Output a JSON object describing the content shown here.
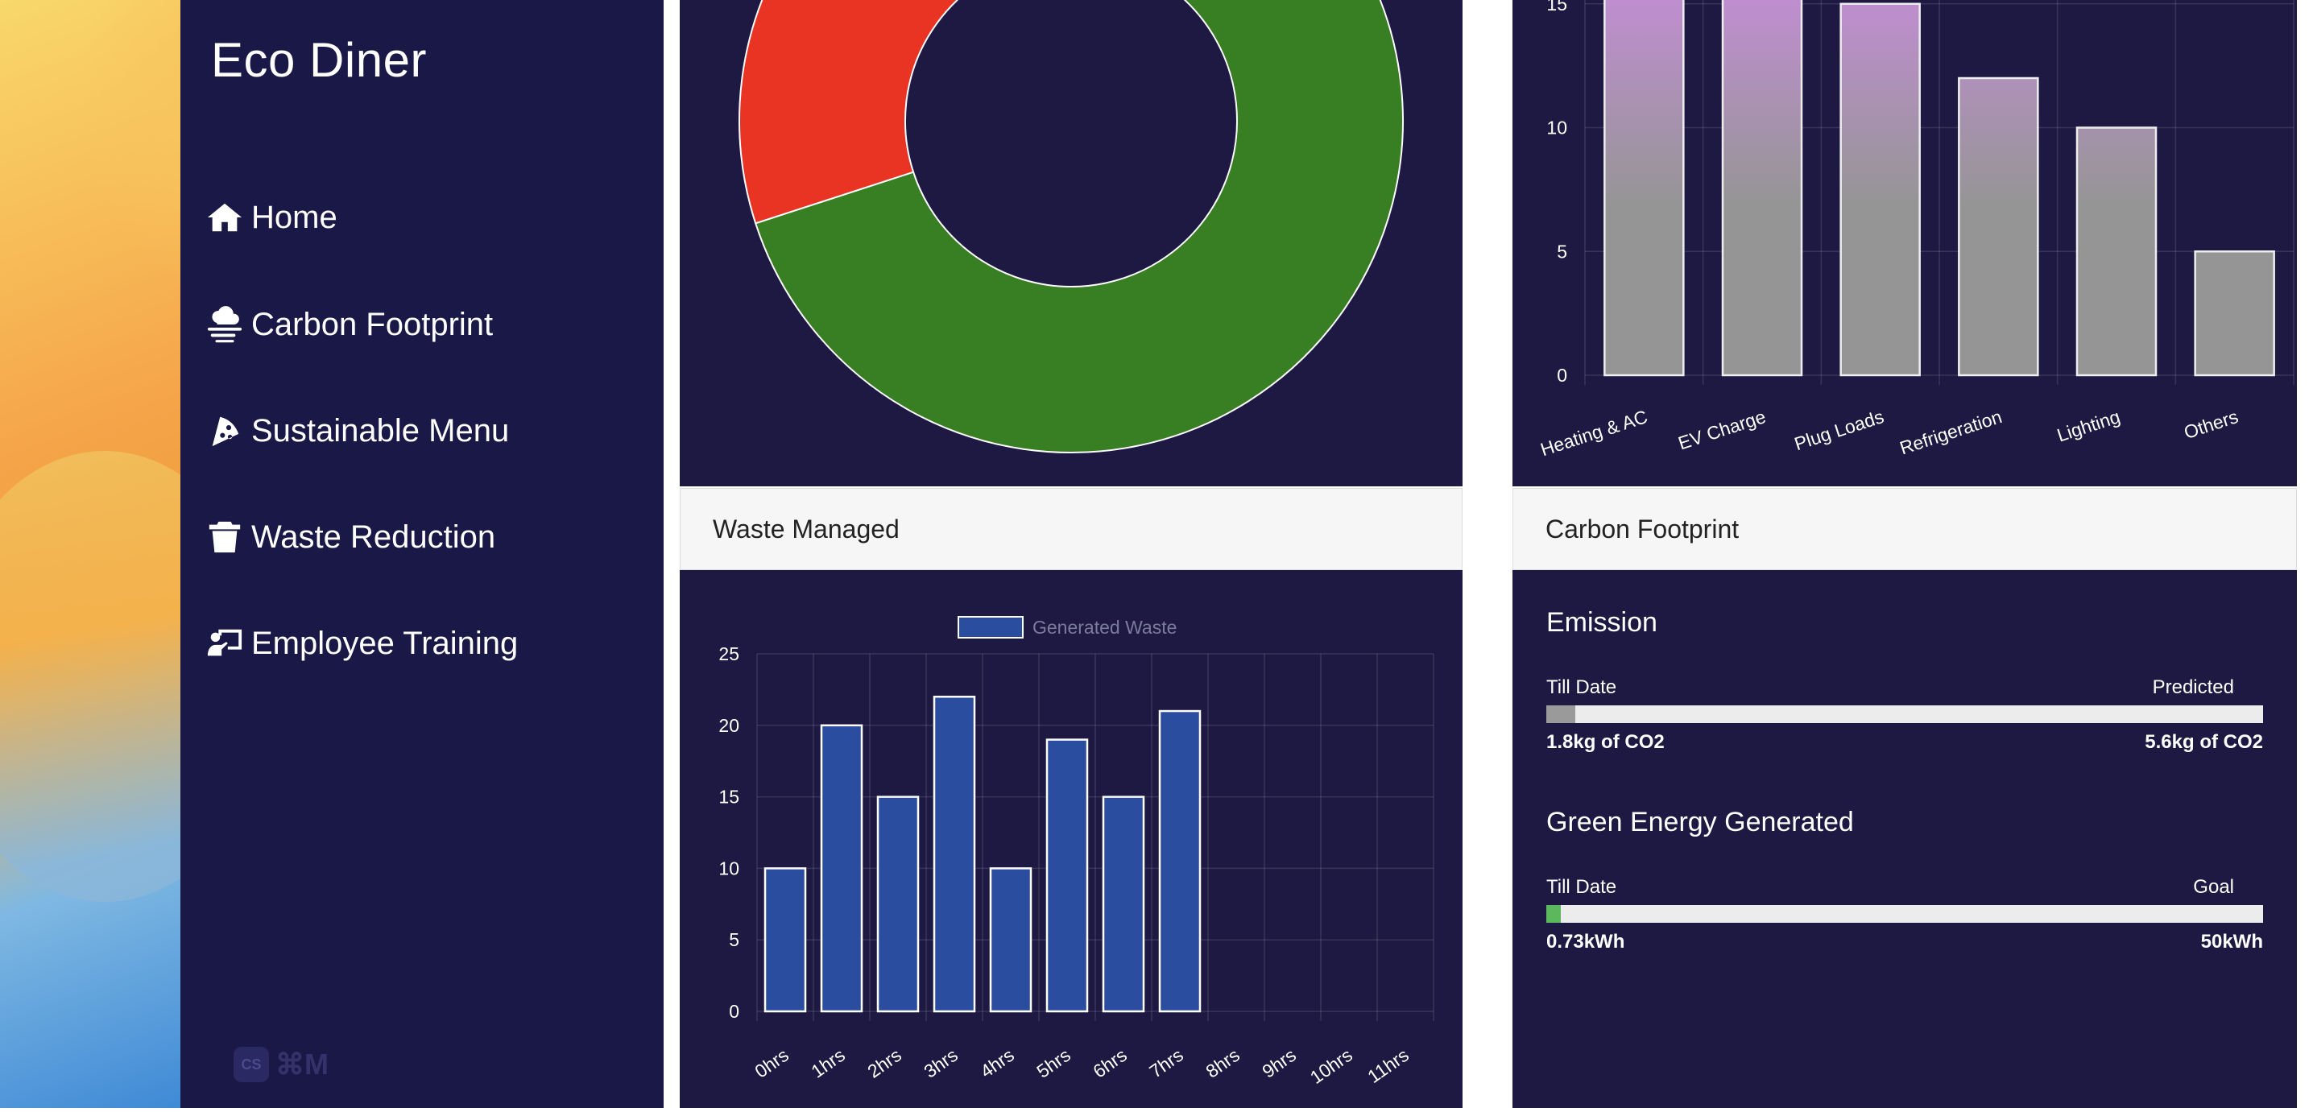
{
  "app": {
    "brand": "Eco Diner"
  },
  "sidebar": {
    "items": [
      {
        "label": "Home",
        "icon": "home-icon"
      },
      {
        "label": "Carbon Footprint",
        "icon": "cloud-smog-icon"
      },
      {
        "label": "Sustainable Menu",
        "icon": "pizza-slice-icon"
      },
      {
        "label": "Waste Reduction",
        "icon": "trash-icon"
      },
      {
        "label": "Employee Training",
        "icon": "chalkboard-teacher-icon"
      }
    ],
    "shortcut_hint": "⌘M",
    "shortcut_badge": "CS"
  },
  "waste_panel": {
    "title": "Waste Managed"
  },
  "carbon_panel": {
    "title": "Carbon Footprint",
    "emission": {
      "heading": "Emission",
      "left_label": "Till Date",
      "right_label": "Predicted",
      "left_value": "1.8kg of CO2",
      "right_value": "5.6kg of CO2",
      "fill_fraction": 0.04,
      "fill_color": "#9a9a9a"
    },
    "green_energy": {
      "heading": "Green Energy Generated",
      "left_label": "Till Date",
      "right_label": "Goal",
      "left_value": "0.73kWh",
      "right_value": "50kWh",
      "fill_fraction": 0.02,
      "fill_color": "#5cb85c"
    }
  },
  "colors": {
    "sidebar_bg": "#1a1847",
    "panel_bg": "#1d1942",
    "donut_green": "#387e22",
    "donut_red": "#e93323",
    "bar_blue": "#2a4da0"
  },
  "chart_data": [
    {
      "type": "pie",
      "variant": "doughnut",
      "values": [
        70,
        30
      ],
      "colors": [
        "#387e22",
        "#e93323"
      ],
      "note_visible": "partially cropped at top"
    },
    {
      "type": "bar",
      "categories": [
        "Heating & AC",
        "EV Charge",
        "Plug Loads",
        "Refrigeration",
        "Lighting",
        "Others"
      ],
      "values": [
        16,
        16,
        15,
        12,
        10,
        5
      ],
      "y_ticks": [
        0,
        5,
        10,
        15
      ],
      "ylim": [
        0,
        16
      ],
      "grid": true
    },
    {
      "type": "bar",
      "legend": [
        "Generated Waste"
      ],
      "legend_position": "top",
      "categories": [
        "0hrs",
        "1hrs",
        "2hrs",
        "3hrs",
        "4hrs",
        "5hrs",
        "6hrs",
        "7hrs",
        "8hrs",
        "9hrs",
        "10hrs",
        "11hrs"
      ],
      "series": [
        {
          "name": "Generated Waste",
          "values": [
            10,
            20,
            15,
            22,
            10,
            19,
            15,
            21,
            null,
            null,
            null,
            null
          ]
        }
      ],
      "y_ticks": [
        0,
        5,
        10,
        15,
        20,
        25
      ],
      "ylim": [
        0,
        25
      ],
      "grid": true
    }
  ]
}
